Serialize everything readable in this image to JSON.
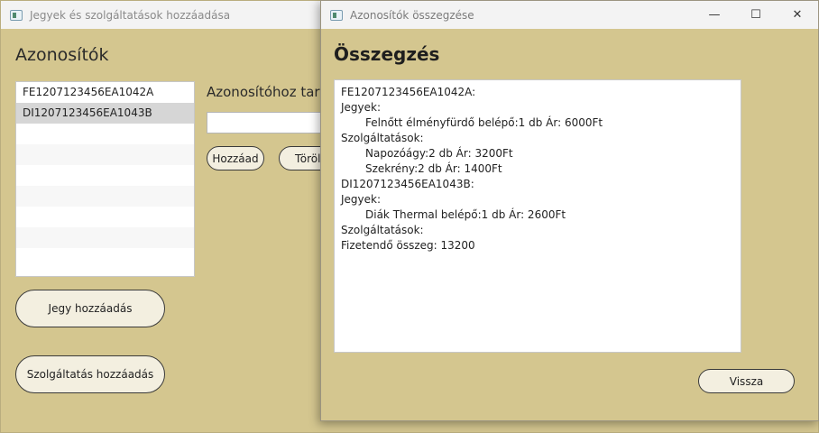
{
  "background_window": {
    "title": "Jegyek és szolgáltatások hozzáadása",
    "heading": "Azonosítók",
    "list_items": [
      "FE1207123456EA1042A",
      "DI1207123456EA1043B"
    ],
    "label": "Azonosítóhoz tarto",
    "add_button": "Hozzáad",
    "delete_button": "Töröl",
    "ticket_button": "Jegy hozzáadás",
    "service_button": "Szolgáltatás hozzáadás"
  },
  "modal": {
    "title": "Azonosítók összegzése",
    "controls": {
      "minimize": "—",
      "maximize": "☐",
      "close": "✕"
    },
    "heading": "Összegzés",
    "summary_lines": [
      {
        "text": "FE1207123456EA1042A:",
        "indent": false
      },
      {
        "text": "Jegyek:",
        "indent": false
      },
      {
        "text": "Felnőtt élményfürdő belépő:1 db Ár: 6000Ft",
        "indent": true
      },
      {
        "text": "Szolgáltatások:",
        "indent": false
      },
      {
        "text": "Napozóágy:2 db Ár: 3200Ft",
        "indent": true
      },
      {
        "text": "Szekrény:2 db Ár: 1400Ft",
        "indent": true
      },
      {
        "text": "DI1207123456EA1043B:",
        "indent": false
      },
      {
        "text": "Jegyek:",
        "indent": false
      },
      {
        "text": "Diák Thermal belépő:1 db Ár: 2600Ft",
        "indent": true
      },
      {
        "text": "Szolgáltatások:",
        "indent": false
      },
      {
        "text": "Fizetendő összeg: 13200",
        "indent": false
      }
    ],
    "back_button": "Vissza"
  }
}
